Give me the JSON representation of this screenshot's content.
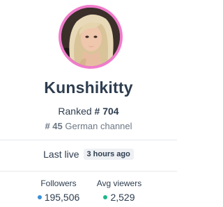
{
  "profile": {
    "name": "Kunshikitty",
    "ranked_label": "Ranked",
    "rank": "# 704",
    "country_rank": "# 45",
    "country_rank_text": "German channel",
    "avatar_ring_color": "#f07ccb"
  },
  "last_live": {
    "label": "Last live",
    "value": "3 hours ago"
  },
  "stats": {
    "followers": {
      "label": "Followers",
      "value": "195,506",
      "dot_color": "#3b8fd6"
    },
    "avg_viewers": {
      "label": "Avg viewers",
      "value": "2,529",
      "dot_color": "#1fb58a"
    }
  }
}
